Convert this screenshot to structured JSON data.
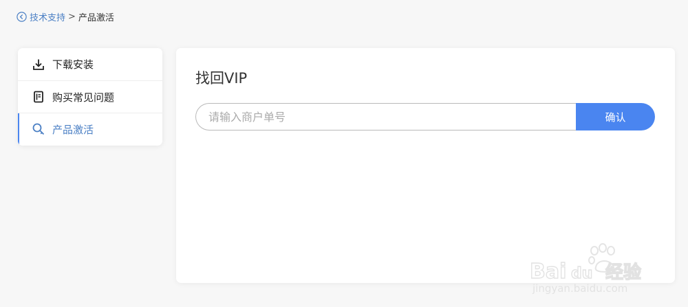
{
  "breadcrumb": {
    "back_label": "技术支持",
    "separator": ">",
    "current": "产品激活"
  },
  "sidebar": {
    "items": [
      {
        "label": "下载安装",
        "icon": "download-icon",
        "active": false
      },
      {
        "label": "购买常见问题",
        "icon": "document-icon",
        "active": false
      },
      {
        "label": "产品激活",
        "icon": "key-search-icon",
        "active": true
      }
    ]
  },
  "main": {
    "title": "找回VIP",
    "input_placeholder": "请输入商户单号",
    "input_value": "",
    "confirm_label": "确认"
  },
  "watermark": {
    "text": "Baidu经验",
    "url_text": "jingyan.baidu.com"
  },
  "colors": {
    "accent": "#4a85f0",
    "link": "#4a7fc4",
    "background": "#f7f7f7"
  }
}
